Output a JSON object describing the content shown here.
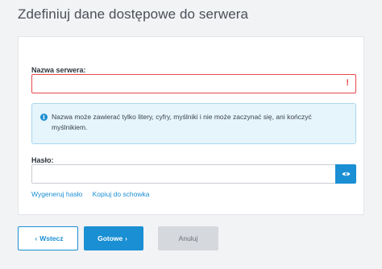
{
  "page": {
    "title": "Zdefiniuj dane dostępowe do serwera"
  },
  "form": {
    "server_name": {
      "label": "Nazwa serwera:",
      "value": "",
      "error_icon": "!"
    },
    "info": {
      "icon": "info-icon",
      "text": "Nazwa może zawierać tylko litery, cyfry, myślniki i nie może zaczynać się, ani kończyć myślnikiem."
    },
    "password": {
      "label": "Hasło:",
      "value": "",
      "toggle_icon": "eye-icon"
    },
    "links": {
      "generate": "Wygeneruj hasło",
      "copy": "Kopiuj do schowka"
    }
  },
  "buttons": {
    "back": {
      "label": "Wstecz",
      "icon": "chevron-left-icon"
    },
    "next": {
      "label": "Gotowe",
      "icon": "chevron-right-icon"
    },
    "cancel": {
      "label": "Anuluj"
    }
  },
  "colors": {
    "accent": "#1a8fd3",
    "error": "#e5484d",
    "info_bg": "#e6f4fb"
  }
}
